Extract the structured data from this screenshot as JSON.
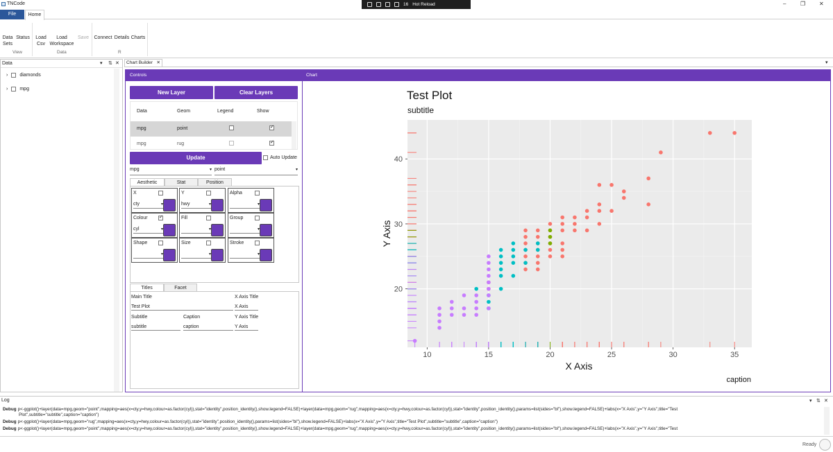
{
  "window": {
    "title": "TNCode"
  },
  "devbar": {
    "count": "16",
    "hot_reload": "Hot Reload"
  },
  "ribbon": {
    "tabs": [
      "File",
      "Home"
    ],
    "buttons": [
      {
        "label": "Data Sets"
      },
      {
        "label": "Status"
      },
      {
        "label": "Load Csv"
      },
      {
        "label": "Load Workspace"
      },
      {
        "label": "Save"
      },
      {
        "label": "Connect"
      },
      {
        "label": "Details"
      },
      {
        "label": "Charts"
      }
    ],
    "groups": [
      "View",
      "Data",
      "R"
    ]
  },
  "data_panel": {
    "title": "Data",
    "items": [
      "diamonds",
      "mpg"
    ]
  },
  "doc_tab": "Chart Builder",
  "controls": {
    "header": "Controls",
    "new_layer": "New Layer",
    "clear_layers": "Clear Layers",
    "columns": [
      "Data",
      "Geom",
      "Legend",
      "Show"
    ],
    "layers": [
      {
        "data": "mpg",
        "geom": "point",
        "legend": false,
        "show": true
      },
      {
        "data": "mpg",
        "geom": "rug",
        "legend": false,
        "show": true
      }
    ],
    "update": "Update",
    "auto_update": "Auto Update",
    "data_select": "mpg",
    "geom_select": "point",
    "tabs": [
      "Aesthetic",
      "Stat",
      "Position"
    ],
    "aesthetics": [
      {
        "name": "X",
        "checked": false,
        "value": "cty"
      },
      {
        "name": "Y",
        "checked": false,
        "value": "hwy"
      },
      {
        "name": "Alpha",
        "checked": false,
        "value": ""
      },
      {
        "name": "Colour",
        "checked": true,
        "value": "cyl"
      },
      {
        "name": "Fill",
        "checked": false,
        "value": ""
      },
      {
        "name": "Group",
        "checked": false,
        "value": ""
      },
      {
        "name": "Shape",
        "checked": false,
        "value": ""
      },
      {
        "name": "Size",
        "checked": false,
        "value": ""
      },
      {
        "name": "Stroke",
        "checked": false,
        "value": ""
      }
    ],
    "title_tabs": [
      "Titles",
      "Facet"
    ],
    "titles": {
      "main_title_label": "Main Title",
      "main_title": "Test Plot",
      "x_axis_title_label": "X Axis Title",
      "x_axis_title": "X Axis",
      "subtitle_label": "Subtitle",
      "subtitle": "subtitle",
      "caption_label": "Caption",
      "caption": "caption",
      "y_axis_title_label": "Y Axis Title",
      "y_axis_title": "Y Axis"
    }
  },
  "chart_panel": {
    "header": "Chart"
  },
  "chart_data": {
    "type": "scatter",
    "title": "Test Plot",
    "subtitle": "subtitle",
    "xlabel": "X Axis",
    "ylabel": "Y Axis",
    "caption": "caption",
    "xlim": [
      8.4,
      36.4
    ],
    "ylim": [
      11,
      46
    ],
    "xticks": [
      10,
      15,
      20,
      25,
      30,
      35
    ],
    "yticks": [
      20,
      30,
      40
    ],
    "grid": true,
    "legend": "none",
    "rug": true,
    "colors": {
      "4": "#F8766D",
      "5": "#7CAE00",
      "6": "#00BFC4",
      "8": "#C77CFF"
    },
    "series": [
      {
        "group": "4",
        "points": [
          [
            15,
            20
          ],
          [
            15,
            21
          ],
          [
            18,
            23
          ],
          [
            18,
            24
          ],
          [
            18,
            25
          ],
          [
            18,
            26
          ],
          [
            18,
            27
          ],
          [
            18,
            28
          ],
          [
            18,
            29
          ],
          [
            19,
            23
          ],
          [
            19,
            24
          ],
          [
            19,
            25
          ],
          [
            19,
            26
          ],
          [
            19,
            27
          ],
          [
            19,
            28
          ],
          [
            19,
            29
          ],
          [
            20,
            25
          ],
          [
            20,
            26
          ],
          [
            20,
            27
          ],
          [
            20,
            28
          ],
          [
            20,
            29
          ],
          [
            20,
            30
          ],
          [
            21,
            25
          ],
          [
            21,
            26
          ],
          [
            21,
            27
          ],
          [
            21,
            29
          ],
          [
            21,
            30
          ],
          [
            21,
            31
          ],
          [
            22,
            29
          ],
          [
            22,
            30
          ],
          [
            22,
            31
          ],
          [
            23,
            29
          ],
          [
            23,
            31
          ],
          [
            23,
            32
          ],
          [
            24,
            30
          ],
          [
            24,
            32
          ],
          [
            24,
            33
          ],
          [
            24,
            36
          ],
          [
            25,
            32
          ],
          [
            25,
            36
          ],
          [
            26,
            34
          ],
          [
            26,
            35
          ],
          [
            28,
            33
          ],
          [
            28,
            37
          ],
          [
            29,
            41
          ],
          [
            33,
            44
          ],
          [
            35,
            44
          ]
        ]
      },
      {
        "group": "5",
        "points": [
          [
            20,
            28
          ],
          [
            20,
            29
          ],
          [
            20,
            27
          ]
        ]
      },
      {
        "group": "6",
        "points": [
          [
            14,
            20
          ],
          [
            15,
            17
          ],
          [
            15,
            18
          ],
          [
            15,
            19
          ],
          [
            16,
            20
          ],
          [
            16,
            22
          ],
          [
            16,
            23
          ],
          [
            16,
            24
          ],
          [
            16,
            25
          ],
          [
            16,
            26
          ],
          [
            17,
            22
          ],
          [
            17,
            24
          ],
          [
            17,
            25
          ],
          [
            17,
            26
          ],
          [
            17,
            27
          ],
          [
            18,
            24
          ],
          [
            18,
            26
          ],
          [
            19,
            26
          ],
          [
            19,
            27
          ]
        ]
      },
      {
        "group": "8",
        "points": [
          [
            9,
            12
          ],
          [
            11,
            14
          ],
          [
            11,
            15
          ],
          [
            11,
            16
          ],
          [
            11,
            17
          ],
          [
            12,
            16
          ],
          [
            12,
            17
          ],
          [
            12,
            18
          ],
          [
            13,
            16
          ],
          [
            13,
            17
          ],
          [
            13,
            19
          ],
          [
            14,
            16
          ],
          [
            14,
            17
          ],
          [
            14,
            18
          ],
          [
            14,
            19
          ],
          [
            15,
            17
          ],
          [
            15,
            19
          ],
          [
            15,
            20
          ],
          [
            15,
            21
          ],
          [
            15,
            22
          ],
          [
            15,
            23
          ],
          [
            15,
            24
          ],
          [
            15,
            25
          ]
        ]
      }
    ]
  },
  "log": {
    "title": "Log",
    "lines": [
      {
        "level": "Debug",
        "text": "p<-ggplot()+layer(data=mpg,geom=\"point\",mapping=aes(x=cty,y=hwy,colour=as.factor(cyl)),stat=\"identity\",position_identity(),show.legend=FALSE)+layer(data=mpg,geom=\"rug\",mapping=aes(x=cty,y=hwy,colour=as.factor(cyl)),stat=\"identity\",position_identity(),params=list(sides=\"bl\"),show.legend=FALSE)+labs(x=\"X Axis\",y=\"Y Axis\",title=\"Test",
        "cont": "Plot\",subtitle=\"subtitle\",caption=\"caption\")"
      },
      {
        "level": "Debug",
        "text": "p<-ggplot()+layer(data=mpg,geom=\"rug\",mapping=aes(x=cty,y=hwy,colour=as.factor(cyl)),stat=\"identity\",position_identity(),params=list(sides=\"bl\"),show.legend=FALSE)+labs(x=\"X Axis\",y=\"Y Axis\",title=\"Test Plot\",subtitle=\"subtitle\",caption=\"caption\")"
      },
      {
        "level": "Debug",
        "text": "p<-ggplot()+layer(data=mpg,geom=\"point\",mapping=aes(x=cty,y=hwy,colour=as.factor(cyl)),stat=\"identity\",position_identity(),show.legend=FALSE)+layer(data=mpg,geom=\"rug\",mapping=aes(x=cty,y=hwy,colour=as.factor(cyl)),stat=\"identity\",position_identity(),params=list(sides=\"bl\"),show.legend=FALSE)+labs(x=\"X Axis\",y=\"Y Axis\",title=\"Test"
      }
    ]
  },
  "status": {
    "text": "Ready"
  }
}
